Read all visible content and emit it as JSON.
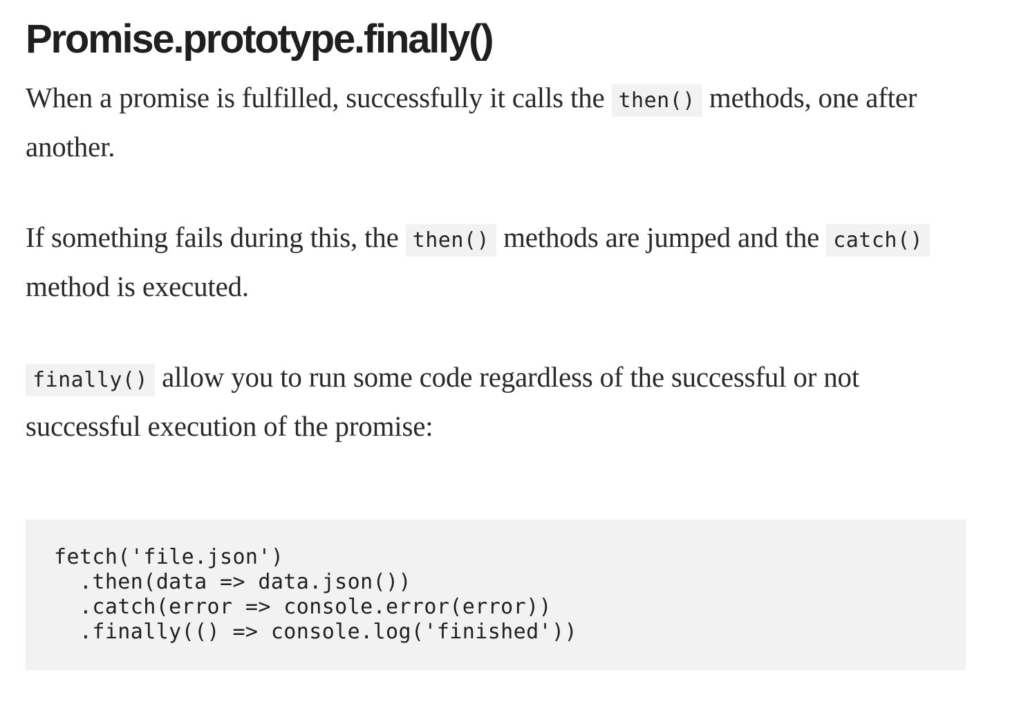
{
  "title": "Promise.prototype.finally()",
  "paragraphs": [
    {
      "before": "When a promise is fulfilled, successfully it calls the ",
      "code": "then()",
      "after": " methods, one after another."
    },
    {
      "before": "If something fails during this, the ",
      "code1": "then()",
      "middle": " methods are jumped and the ",
      "code2": "catch()",
      "after": " method is executed."
    },
    {
      "code": "finally()",
      "after": " allow you to run some code regardless of the successful or not successful execution of the promise:"
    }
  ],
  "code_block": {
    "lines": [
      "fetch('file.json')",
      "  .then(data => data.json())",
      "  .catch(error => console.error(error))",
      "  .finally(() => console.log('finished'))"
    ]
  }
}
